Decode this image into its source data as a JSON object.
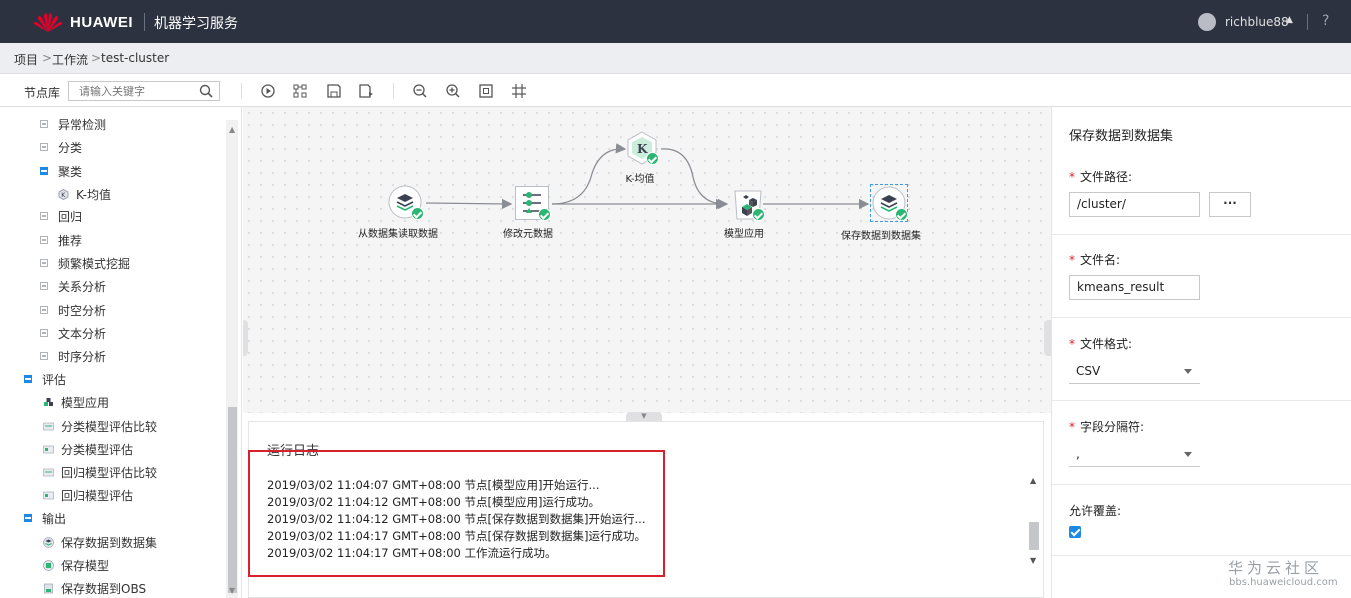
{
  "header": {
    "brand": "HUAWEI",
    "service": "机器学习服务",
    "user": "richblue88",
    "help": "?"
  },
  "breadcrumb": {
    "items": [
      "项目",
      "工作流",
      "test-cluster"
    ],
    "separator": ">"
  },
  "toolbar": {
    "node_lib_label": "节点库",
    "search_placeholder": "请输入关键字",
    "buttons": [
      "run-icon",
      "layout-icon",
      "save-icon",
      "save-as-icon",
      "zoom-out-icon",
      "zoom-in-icon",
      "fit-icon",
      "grid-icon"
    ]
  },
  "sidebar": {
    "items": [
      {
        "label": "异常检测",
        "type": "group",
        "expanded": false
      },
      {
        "label": "分类",
        "type": "group",
        "expanded": false
      },
      {
        "label": "聚类",
        "type": "group",
        "expanded": true
      },
      {
        "label": "K-均值",
        "type": "leaf"
      },
      {
        "label": "回归",
        "type": "group",
        "expanded": false
      },
      {
        "label": "推荐",
        "type": "group",
        "expanded": false
      },
      {
        "label": "频繁模式挖掘",
        "type": "group",
        "expanded": false
      },
      {
        "label": "关系分析",
        "type": "group",
        "expanded": false
      },
      {
        "label": "时空分析",
        "type": "group",
        "expanded": false
      },
      {
        "label": "文本分析",
        "type": "group",
        "expanded": false
      },
      {
        "label": "时序分析",
        "type": "group",
        "expanded": false
      },
      {
        "label": "评估",
        "type": "root",
        "expanded": true
      },
      {
        "label": "模型应用",
        "type": "leaf"
      },
      {
        "label": "分类模型评估比较",
        "type": "leaf"
      },
      {
        "label": "分类模型评估",
        "type": "leaf"
      },
      {
        "label": "回归模型评估比较",
        "type": "leaf"
      },
      {
        "label": "回归模型评估",
        "type": "leaf"
      },
      {
        "label": "输出",
        "type": "root",
        "expanded": true
      },
      {
        "label": "保存数据到数据集",
        "type": "leaf"
      },
      {
        "label": "保存模型",
        "type": "leaf"
      },
      {
        "label": "保存数据到OBS",
        "type": "leaf"
      }
    ]
  },
  "workflow": {
    "nodes": [
      {
        "label": "从数据集读取数据",
        "status": "success"
      },
      {
        "label": "修改元数据",
        "status": "success"
      },
      {
        "label": "K-均值",
        "status": "success"
      },
      {
        "label": "模型应用",
        "status": "success"
      },
      {
        "label": "保存数据到数据集",
        "status": "success"
      }
    ]
  },
  "log": {
    "title": "运行日志",
    "lines": [
      "2019/03/02 11:04:07 GMT+08:00 节点[模型应用]开始运行...",
      "2019/03/02 11:04:12 GMT+08:00 节点[模型应用]运行成功。",
      "2019/03/02 11:04:12 GMT+08:00 节点[保存数据到数据集]开始运行...",
      "2019/03/02 11:04:17 GMT+08:00 节点[保存数据到数据集]运行成功。",
      "2019/03/02 11:04:17 GMT+08:00 工作流运行成功。"
    ]
  },
  "properties": {
    "title": "保存数据到数据集",
    "file_path_label": "文件路径:",
    "file_path_value": "/cluster/",
    "browse_label": "···",
    "file_name_label": "文件名:",
    "file_name_value": "kmeans_result",
    "format_label": "文件格式:",
    "format_value": "CSV",
    "delimiter_label": "字段分隔符:",
    "delimiter_value": ",",
    "overwrite_label": "允许覆盖:",
    "overwrite_checked": true
  },
  "watermark": {
    "title": "华为云社区",
    "url": "bbs.huaweicloud.com"
  },
  "colors": {
    "header_bg": "#2d3240",
    "accent": "#1e88e5",
    "success": "#2bb673",
    "highlight": "#d9212e"
  }
}
